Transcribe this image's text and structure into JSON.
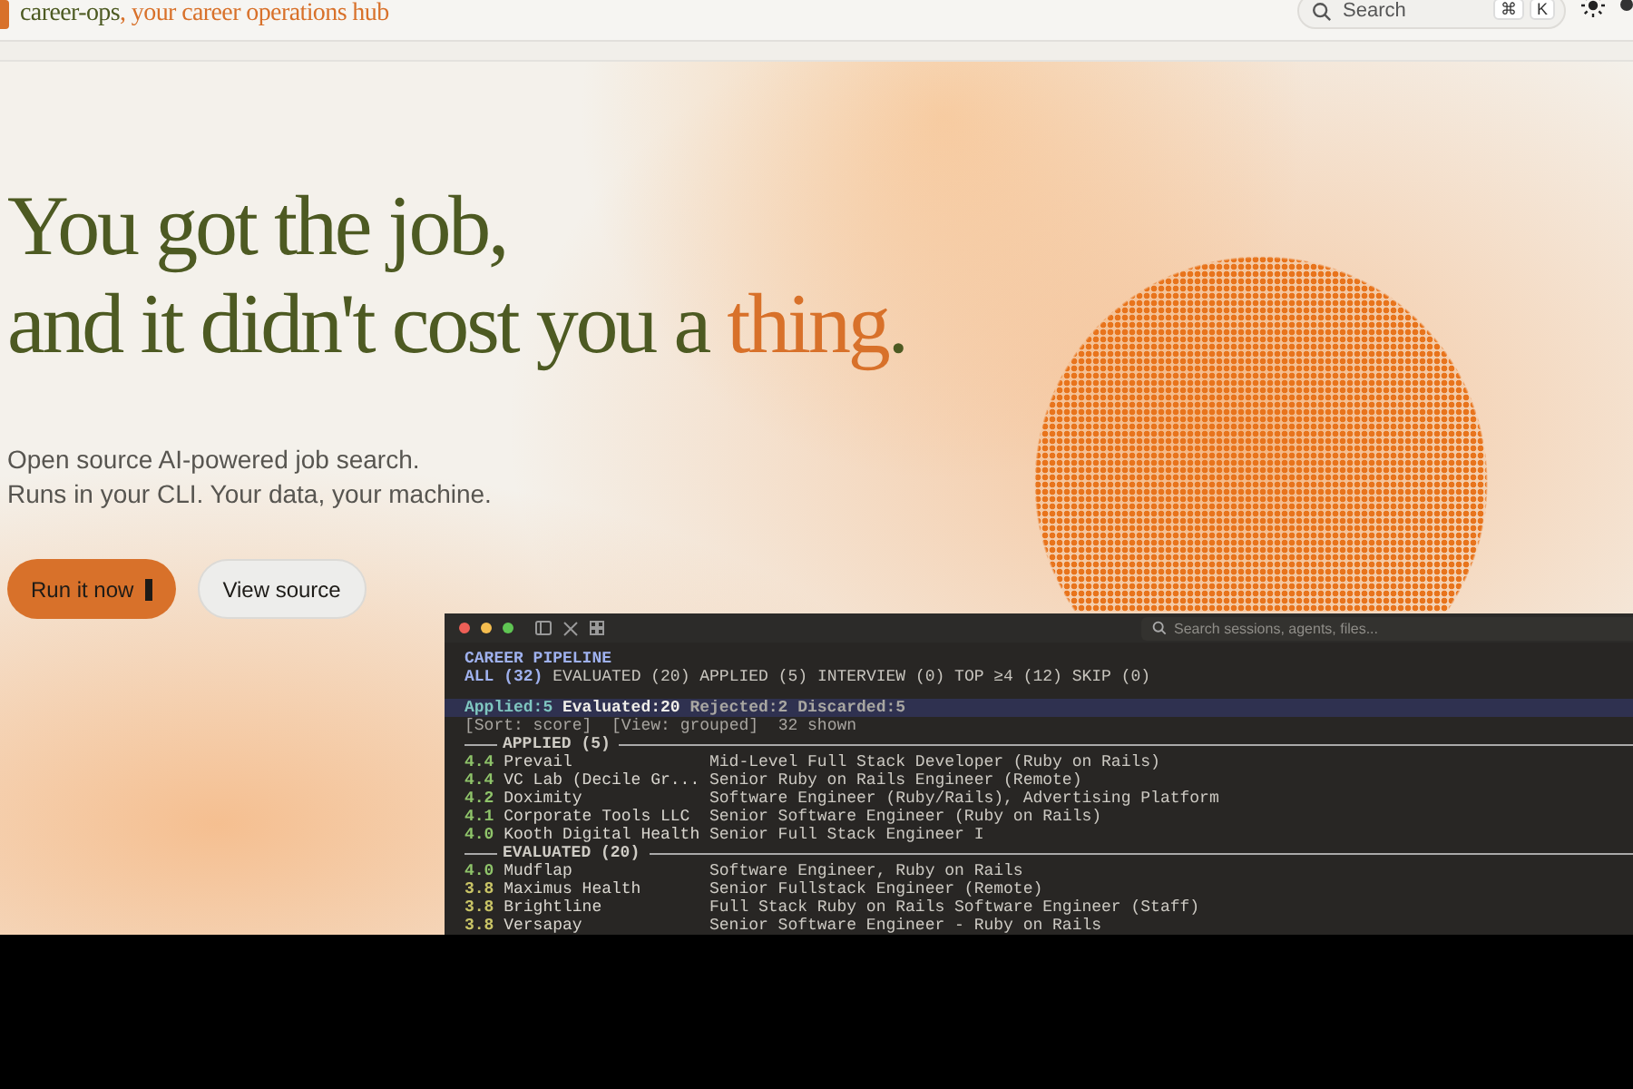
{
  "header": {
    "brand": "career-ops",
    "tagline": ", your career operations hub",
    "search": {
      "placeholder": "Search"
    },
    "shortcut_keys": [
      "⌘",
      "K"
    ]
  },
  "hero": {
    "headline_line_1": "You got the job,",
    "headline_line_2": "and it didn't cost you a ",
    "headline_accent": "thing",
    "headline_end": ".",
    "subtitle_lines": [
      "Open source AI-powered job search.",
      "Runs in your CLI. Your data, your machine."
    ],
    "buttons": [
      {
        "label": "Run it now",
        "kind": "primary"
      },
      {
        "label": "View source",
        "kind": "secondary"
      }
    ]
  },
  "terminal": {
    "search": {
      "placeholder": "Search sessions, agents, files..."
    },
    "title": "CAREER PIPELINE",
    "filters": [
      {
        "label": "ALL (32)",
        "selected": true
      },
      {
        "label": "EVALUATED (20)",
        "selected": false
      },
      {
        "label": "APPLIED (5)",
        "selected": false
      },
      {
        "label": "INTERVIEW (0)",
        "selected": false
      },
      {
        "label": "TOP ≥4 (12)",
        "selected": false
      },
      {
        "label": "SKIP (0)",
        "selected": false
      }
    ],
    "stats": [
      {
        "label": "Applied:5",
        "kind": "accent"
      },
      {
        "label": "Evaluated:20",
        "kind": "bright"
      },
      {
        "label": "Rejected:2",
        "kind": "muted"
      },
      {
        "label": "Discarded:5",
        "kind": "muted"
      }
    ],
    "meta": "[Sort: score]  [View: grouped]  32 shown",
    "groups": [
      {
        "title": "APPLIED (5)",
        "rows": [
          {
            "score": "4.4",
            "company": "Prevail",
            "role": "Mid-Level Full Stack Developer (Ruby on Rails)",
            "color": "#8fc46a"
          },
          {
            "score": "4.4",
            "company": "VC Lab (Decile Gr...",
            "role": "Senior Ruby on Rails Engineer (Remote)",
            "color": "#8fc46a"
          },
          {
            "score": "4.2",
            "company": "Doximity",
            "role": "Software Engineer (Ruby/Rails), Advertising Platform",
            "color": "#8fc46a"
          },
          {
            "score": "4.1",
            "company": "Corporate Tools LLC",
            "role": "Senior Software Engineer (Ruby on Rails)",
            "color": "#8fc46a"
          },
          {
            "score": "4.0",
            "company": "Kooth Digital Health",
            "role": "Senior Full Stack Engineer I",
            "color": "#8fc46a"
          }
        ]
      },
      {
        "title": "EVALUATED (20)",
        "rows": [
          {
            "score": "4.0",
            "company": "Mudflap",
            "role": "Software Engineer, Ruby on Rails",
            "color": "#8fc46a"
          },
          {
            "score": "3.8",
            "company": "Maximus Health",
            "role": "Senior Fullstack Engineer (Remote)",
            "color": "#c9c466"
          },
          {
            "score": "3.8",
            "company": "Brightline",
            "role": "Full Stack Ruby on Rails Software Engineer (Staff)",
            "color": "#c9c466"
          },
          {
            "score": "3.8",
            "company": "Versapay",
            "role": "Senior Software Engineer - Ruby on Rails",
            "color": "#c9c466"
          }
        ]
      }
    ]
  }
}
